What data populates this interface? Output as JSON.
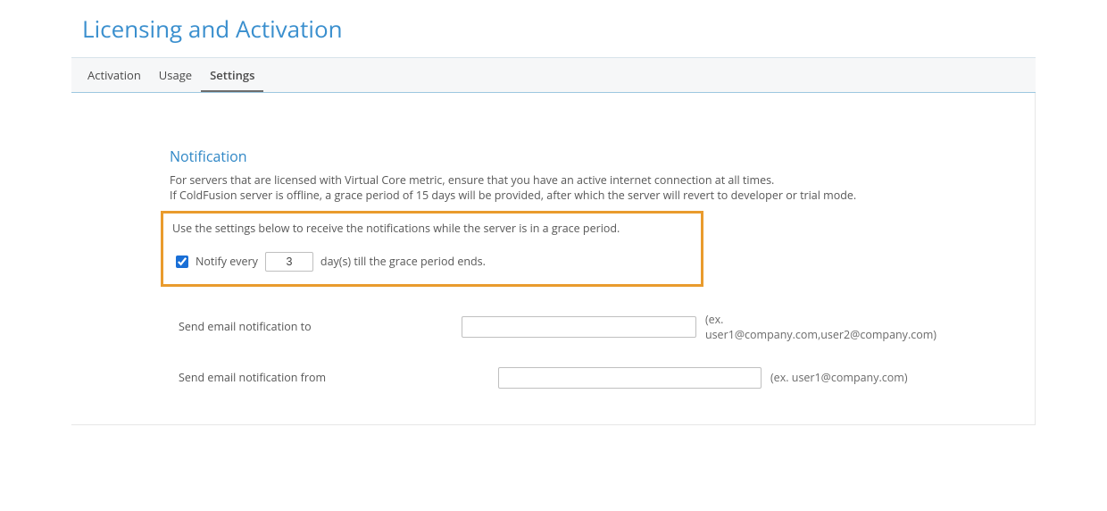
{
  "page": {
    "title": "Licensing and Activation"
  },
  "tabs": [
    {
      "label": "Activation"
    },
    {
      "label": "Usage"
    },
    {
      "label": "Settings"
    }
  ],
  "notification": {
    "heading": "Notification",
    "line1": "For servers that are licensed with Virtual Core metric, ensure that you have an active internet connection at all times.",
    "line2": "If ColdFusion server is offline, a grace period of 15 days will be provided, after which the server will revert to developer or trial mode.",
    "instruction": "Use the settings below to receive the notifications while the server is in a grace period.",
    "notify": {
      "checked": true,
      "prefix": "Notify every",
      "days_value": "3",
      "suffix": "day(s) till the grace period ends."
    },
    "email_to": {
      "label": "Send email notification to",
      "value": "",
      "hint": "(ex. user1@company.com,user2@company.com)"
    },
    "email_from": {
      "label": "Send email notification from",
      "value": "",
      "hint": "(ex. user1@company.com)"
    }
  }
}
